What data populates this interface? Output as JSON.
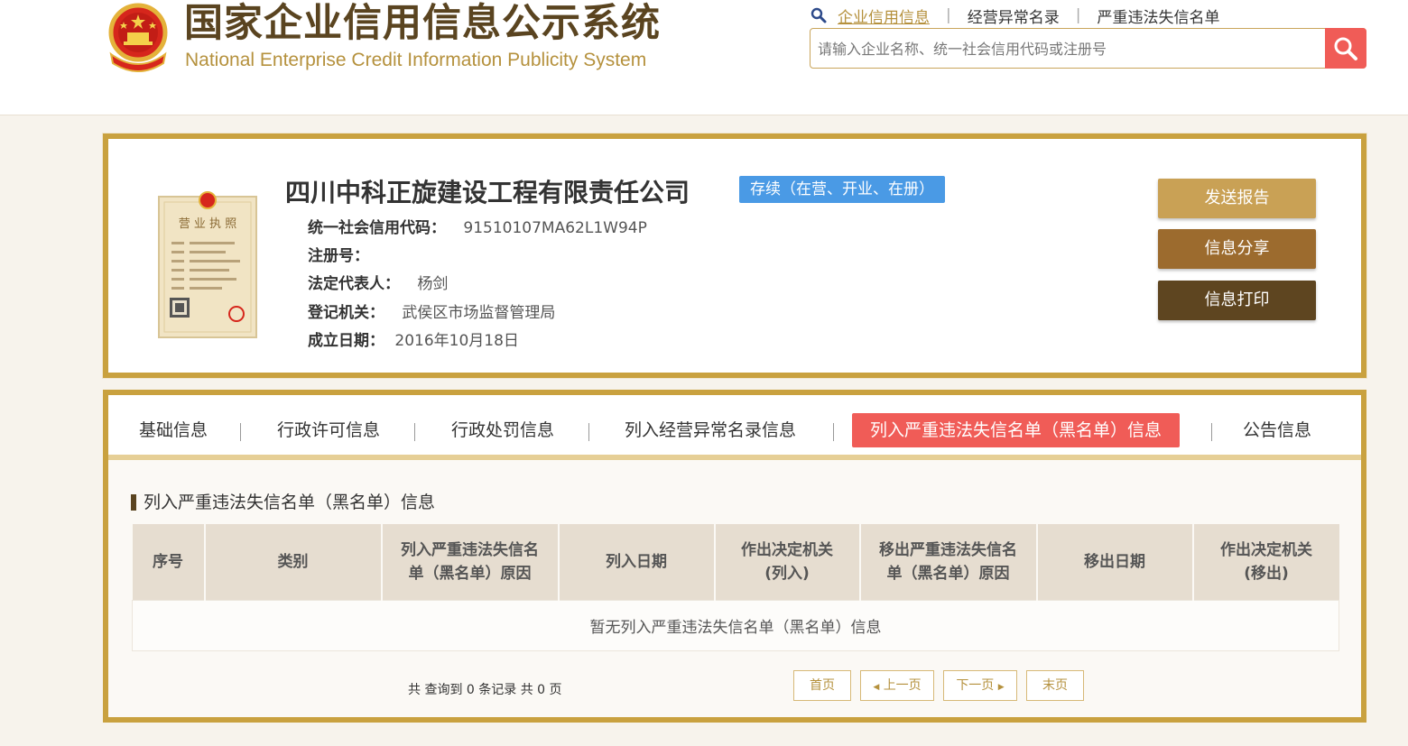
{
  "header": {
    "title_cn": "国家企业信用信息公示系统",
    "title_en": "National Enterprise Credit Information Publicity System",
    "nav": [
      {
        "label": "企业信用信息",
        "active": true
      },
      {
        "label": "经营异常名录",
        "active": false
      },
      {
        "label": "严重违法失信名单",
        "active": false
      }
    ],
    "nav_sep": "|",
    "search_placeholder": "请输入企业名称、统一社会信用代码或注册号"
  },
  "company": {
    "name": "四川中科正旋建设工程有限责任公司",
    "status": "存续（在营、开业、在册）",
    "fields": [
      {
        "label": "统一社会信用代码：",
        "value": "91510107MA62L1W94P"
      },
      {
        "label": "注册号：",
        "value": ""
      },
      {
        "label": "法定代表人：",
        "value": "杨剑"
      },
      {
        "label": "登记机关：",
        "value": "武侯区市场监督管理局"
      },
      {
        "label": "成立日期：",
        "value": "2016年10月18日"
      }
    ],
    "license_title": "营 业 执 照"
  },
  "actions": {
    "send_report": "发送报告",
    "share": "信息分享",
    "print": "信息打印"
  },
  "tabs": [
    {
      "label": "基础信息",
      "active": false
    },
    {
      "label": "行政许可信息",
      "active": false
    },
    {
      "label": "行政处罚信息",
      "active": false
    },
    {
      "label": "列入经营异常名录信息",
      "active": false
    },
    {
      "label": "列入严重违法失信名单（黑名单）信息",
      "active": true
    },
    {
      "label": "公告信息",
      "active": false
    }
  ],
  "section": {
    "title": "列入严重违法失信名单（黑名单）信息",
    "columns": [
      [
        "序号"
      ],
      [
        "类别"
      ],
      [
        "列入严重违法失信名",
        "单（黑名单）原因"
      ],
      [
        "列入日期"
      ],
      [
        "作出决定机关",
        "(列入)"
      ],
      [
        "移出严重违法失信名",
        "单（黑名单）原因"
      ],
      [
        "移出日期"
      ],
      [
        "作出决定机关",
        "(移出)"
      ]
    ],
    "empty_text": "暂无列入严重违法失信名单（黑名单）信息"
  },
  "pager": {
    "summary": "共 查询到 0 条记录 共 0 页",
    "first": "首页",
    "prev": "上一页",
    "next": "下一页",
    "last": "末页"
  },
  "colors": {
    "gold_border": "#c9a13f",
    "btn_send": "#c9a155",
    "btn_share": "#9c6b2e",
    "btn_print": "#5e4520",
    "active_tab": "#f05c57",
    "status_badge": "#4a9ae5"
  }
}
